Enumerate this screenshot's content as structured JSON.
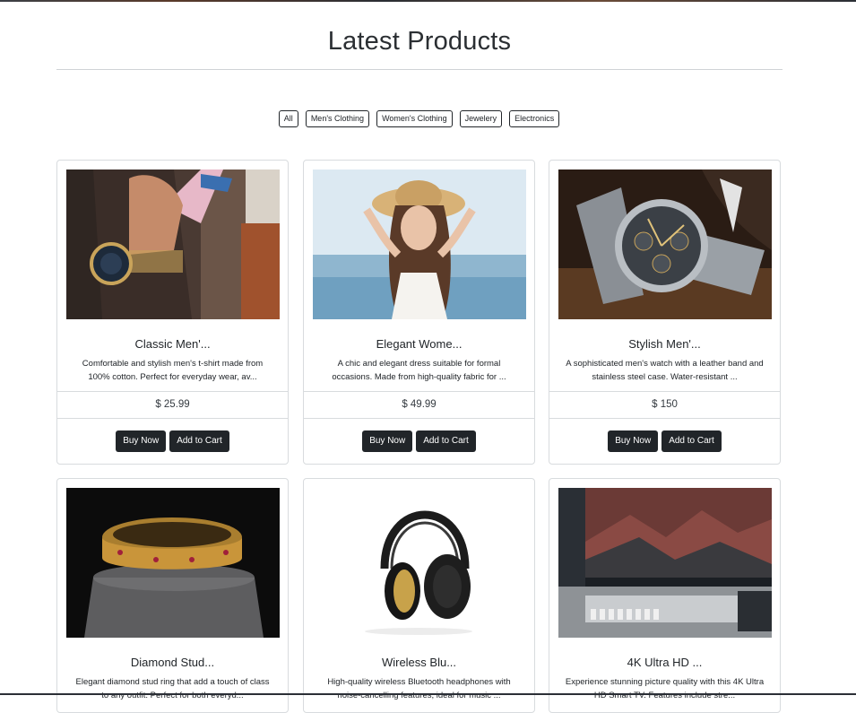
{
  "page": {
    "title": "Latest Products"
  },
  "filters": [
    "All",
    "Men's Clothing",
    "Women's Clothing",
    "Jewelery",
    "Electronics"
  ],
  "products": [
    {
      "name": "Classic Men'...",
      "desc_line1": "Comfortable and stylish men's t-shirt made from",
      "desc_line2": "100% cotton. Perfect for everyday wear, av...",
      "price": "$ 25.99",
      "buy_label": "Buy Now",
      "cart_label": "Add to Cart",
      "image_icon": "wristwatch-suit-photo"
    },
    {
      "name": "Elegant Wome...",
      "desc_line1": "A chic and elegant dress suitable for formal",
      "desc_line2": "occasions. Made from high-quality fabric for ...",
      "price": "$ 49.99",
      "buy_label": "Buy Now",
      "cart_label": "Add to Cart",
      "image_icon": "woman-straw-hat-photo"
    },
    {
      "name": "Stylish Men'...",
      "desc_line1": "A sophisticated men's watch with a leather band and",
      "desc_line2": "stainless steel case. Water-resistant ...",
      "price": "$ 150",
      "buy_label": "Buy Now",
      "cart_label": "Add to Cart",
      "image_icon": "chronograph-watch-photo"
    },
    {
      "name": "Diamond Stud...",
      "desc_line1": "Elegant diamond stud ring that add a touch of class",
      "desc_line2": "to any outfit. Perfect for both everyd...",
      "image_icon": "gold-bracelet-photo"
    },
    {
      "name": "Wireless Blu...",
      "desc_line1": "High-quality wireless Bluetooth headphones with",
      "desc_line2": "noise-cancelling features, ideal for music ...",
      "image_icon": "headphones-photo"
    },
    {
      "name": "4K Ultra HD ...",
      "desc_line1": "Experience stunning picture quality with this 4K Ultra",
      "desc_line2": "HD Smart TV. Features include stre...",
      "image_icon": "monitor-keyboard-photo"
    }
  ]
}
